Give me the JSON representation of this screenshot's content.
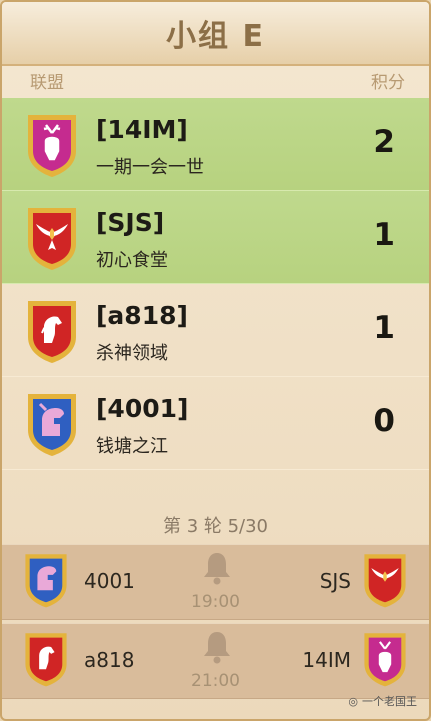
{
  "header": {
    "title": "小组 E"
  },
  "columns": {
    "alliance": "联盟",
    "points": "积分"
  },
  "alliances": [
    {
      "tag": "[14IM]",
      "name": "一期一会一世",
      "points": "2",
      "highlighted": true,
      "badge_icon": "deer-icon",
      "badge_color": "#c52b8f"
    },
    {
      "tag": "[SJS]",
      "name": "初心食堂",
      "points": "1",
      "highlighted": true,
      "badge_icon": "winged-emblem-icon",
      "badge_color": "#d02525"
    },
    {
      "tag": "[a818]",
      "name": "杀神领域",
      "points": "1",
      "highlighted": false,
      "badge_icon": "horse-icon",
      "badge_color": "#d02525"
    },
    {
      "tag": "[4001]",
      "name": "钱塘之江",
      "points": "0",
      "highlighted": false,
      "badge_icon": "helmet-icon",
      "badge_color": "#2f5fc1"
    }
  ],
  "round": {
    "label": "第 3 轮 5/30"
  },
  "matches": [
    {
      "left_team": "4001",
      "right_team": "SJS",
      "time": "19:00",
      "left_icon": "helmet-icon",
      "right_icon": "winged-emblem-icon"
    },
    {
      "left_team": "a818",
      "right_team": "14IM",
      "time": "21:00",
      "left_icon": "horse-icon",
      "right_icon": "deer-icon"
    }
  ],
  "watermark": {
    "text": "一个老国王"
  },
  "colors": {
    "highlight": "#bcd788",
    "gold_border": "#e4b33c"
  }
}
